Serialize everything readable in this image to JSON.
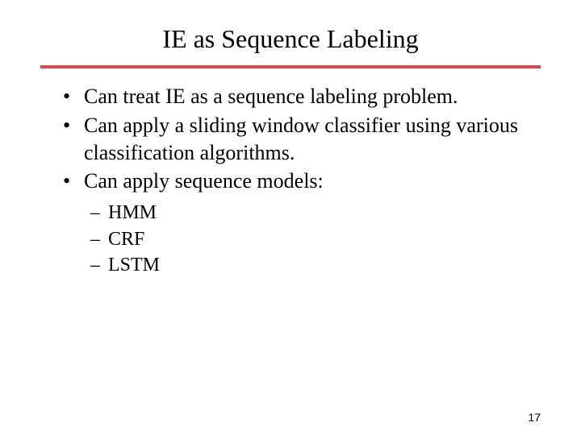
{
  "slide": {
    "title": "IE as Sequence Labeling",
    "bullets": [
      "Can treat IE as a sequence labeling problem.",
      "Can apply a sliding window classifier using various classification algorithms.",
      "Can apply sequence models:"
    ],
    "sub_bullets": [
      "HMM",
      "CRF",
      "LSTM"
    ],
    "page_number": "17"
  }
}
